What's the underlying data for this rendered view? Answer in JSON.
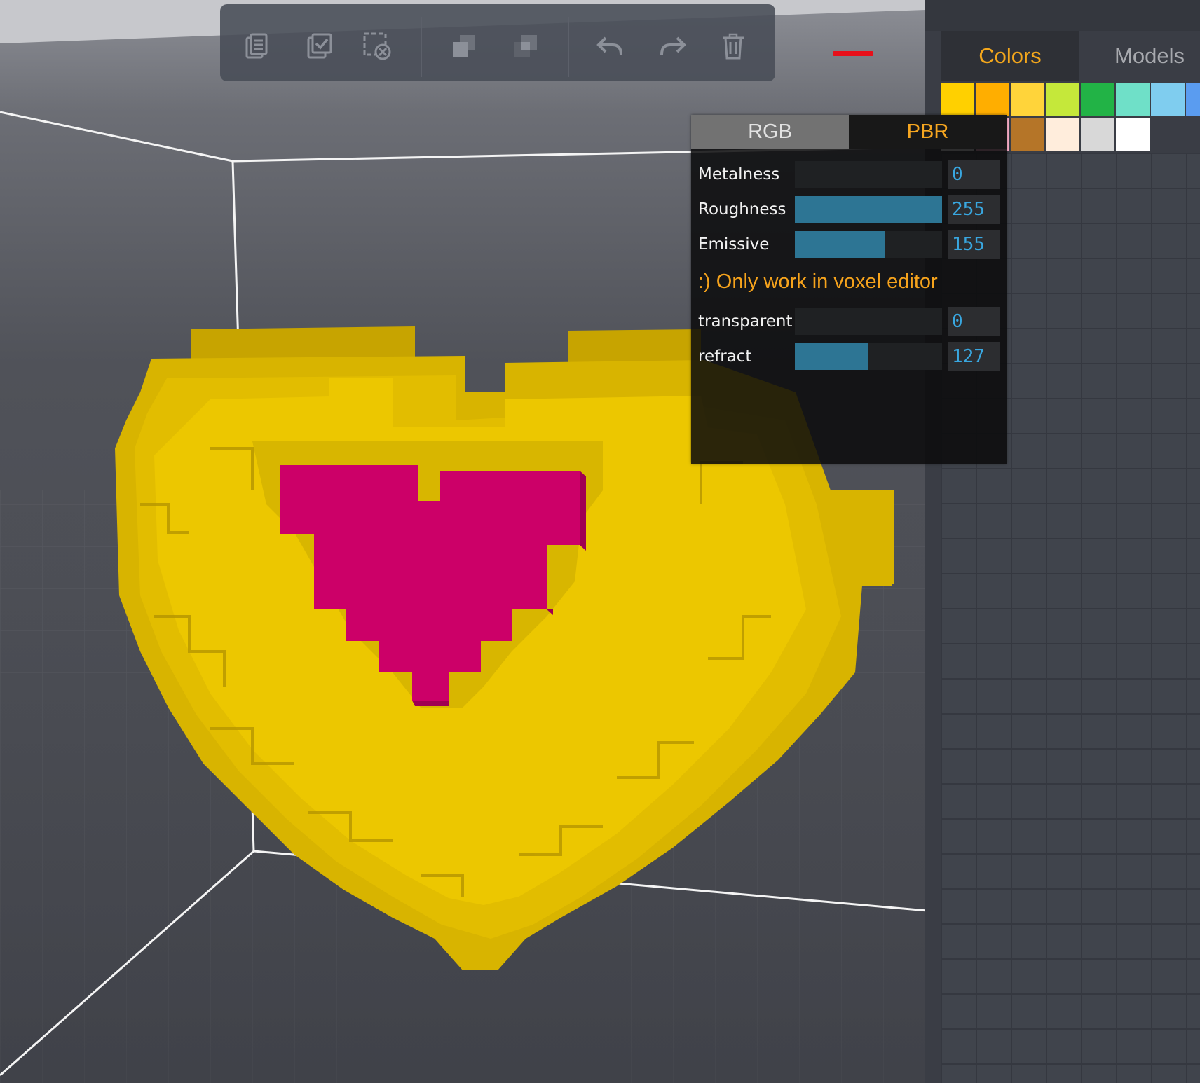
{
  "toolbar": {
    "buttons": [
      {
        "id": "copy",
        "icon": "clipboard-icon"
      },
      {
        "id": "select",
        "icon": "select-copy-icon"
      },
      {
        "id": "deselect",
        "icon": "deselect-icon"
      },
      {
        "id": "copy-up",
        "icon": "layer-copy-icon"
      },
      {
        "id": "copy-down",
        "icon": "layer-paste-icon"
      },
      {
        "id": "undo",
        "icon": "undo-icon"
      },
      {
        "id": "redo",
        "icon": "redo-icon"
      },
      {
        "id": "delete",
        "icon": "trash-icon"
      }
    ]
  },
  "side_panel": {
    "tabs": [
      {
        "label": "Colors",
        "active": true
      },
      {
        "label": "Models",
        "active": false
      }
    ],
    "palette": [
      "#ffd000",
      "#ffae00",
      "#ffd43a",
      "#c5e83a",
      "#22b346",
      "#6fe0c8",
      "#7fcdef",
      "#5a9cf0",
      "#ff0a82",
      "#ffb2cc",
      "#b57528",
      "#ffeddc",
      "#d8d8d8",
      "#ffffff"
    ],
    "selected_color": "#ff0a82"
  },
  "pbr_panel": {
    "tabs": [
      {
        "label": "RGB",
        "active": false
      },
      {
        "label": "PBR",
        "active": true
      }
    ],
    "sliders": [
      {
        "label": "Metalness",
        "value": "0",
        "fraction": 0
      },
      {
        "label": "Roughness",
        "value": "255",
        "fraction": 1.0
      },
      {
        "label": "Emissive",
        "value": "155",
        "fraction": 0.608
      }
    ],
    "note": ":) Only work in voxel editor",
    "sliders2": [
      {
        "label": "transparent",
        "value": "0",
        "fraction": 0
      },
      {
        "label": "refract",
        "value": "127",
        "fraction": 0.498
      }
    ]
  },
  "colors": {
    "accent": "#f4a71c",
    "heart_outer": "#e2bd00",
    "heart_inner": "#d1006f",
    "slider_fill": "#2d7594",
    "value_text": "#39a7e0"
  }
}
